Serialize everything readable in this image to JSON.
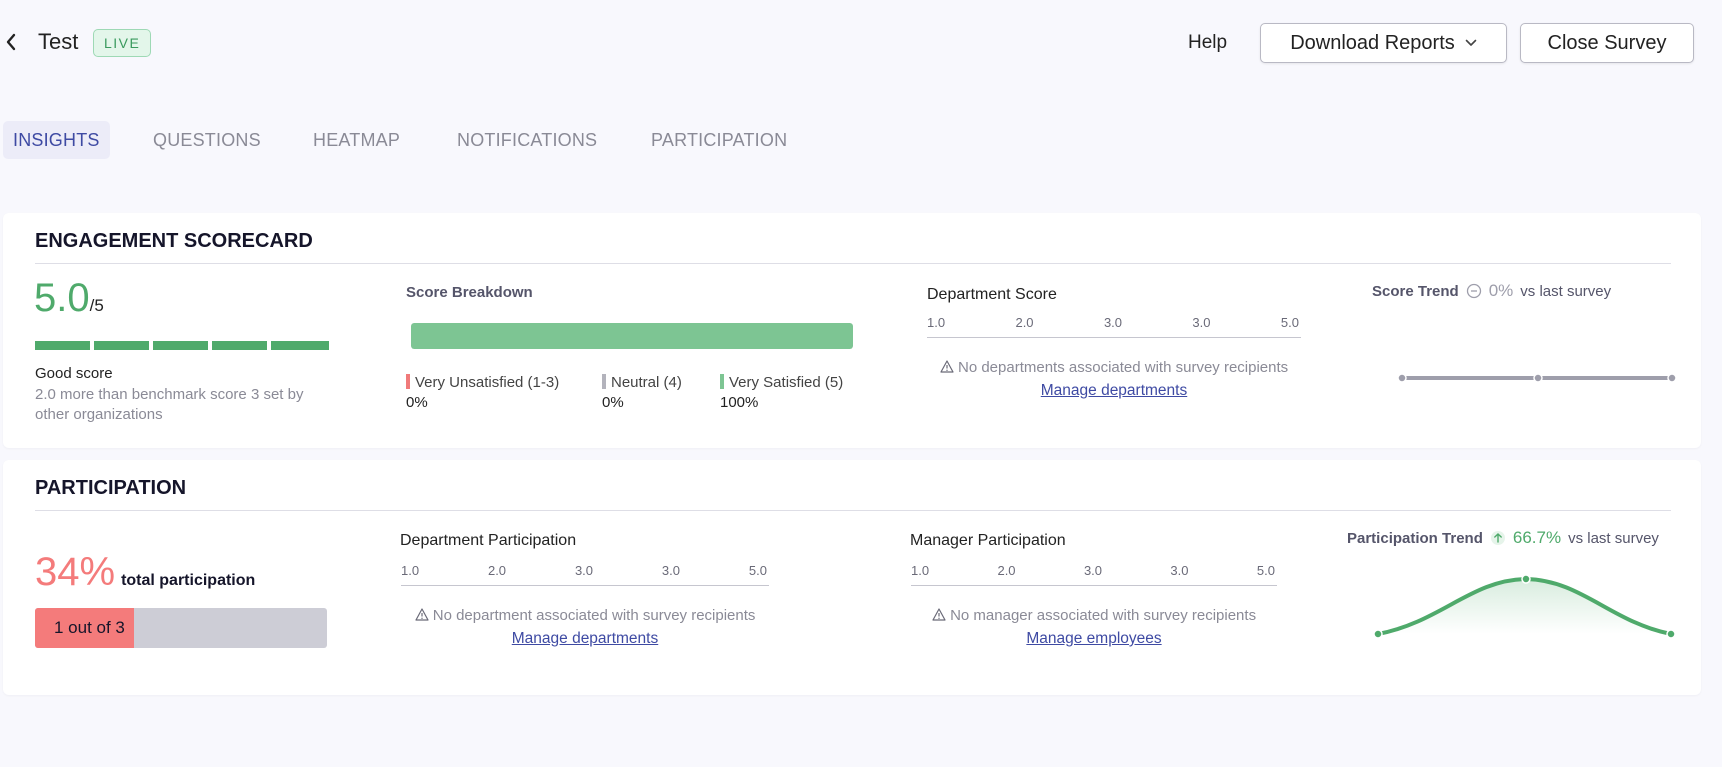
{
  "header": {
    "title": "Test",
    "status_badge": "LIVE",
    "help_label": "Help",
    "download_label": "Download Reports",
    "close_label": "Close Survey"
  },
  "tabs": [
    {
      "label": "INSIGHTS",
      "active": true
    },
    {
      "label": "QUESTIONS"
    },
    {
      "label": "HEATMAP"
    },
    {
      "label": "NOTIFICATIONS"
    },
    {
      "label": "PARTICIPATION"
    }
  ],
  "engagement": {
    "title": "ENGAGEMENT SCORECARD",
    "score": "5.0",
    "score_max": "/5",
    "score_label": "Good score",
    "score_description": "2.0 more than benchmark score 3 set by other organizations",
    "breakdown_title": "Score Breakdown",
    "breakdown": [
      {
        "label": "Very Unsatisfied (1-3)",
        "value": "0%",
        "color": "#f07a7a"
      },
      {
        "label": "Neutral (4)",
        "value": "0%",
        "color": "#b3b3bc"
      },
      {
        "label": "Very Satisfied (5)",
        "value": "100%",
        "color": "#7dc593"
      }
    ],
    "satisfied_fraction": 1.0,
    "department_title": "Department Score",
    "department_axis": [
      "1.0",
      "2.0",
      "3.0",
      "3.0",
      "5.0"
    ],
    "department_empty": "No departments associated with survey recipients",
    "manage_departments": "Manage departments",
    "trend_title": "Score Trend",
    "trend_value": "0%",
    "trend_suffix": "vs last survey",
    "trend_color": "#9e9eab"
  },
  "participation": {
    "title": "PARTICIPATION",
    "percent": "34%",
    "percent_label": "total participation",
    "bar_label": "1 out of 3",
    "fraction": 0.34,
    "bar_color": "#f47b7b",
    "dept_title": "Department Participation",
    "dept_axis": [
      "1.0",
      "2.0",
      "3.0",
      "3.0",
      "5.0"
    ],
    "dept_empty": "No department associated with survey recipients",
    "dept_manage": "Manage departments",
    "manager_title": "Manager Participation",
    "manager_axis": [
      "1.0",
      "2.0",
      "3.0",
      "3.0",
      "5.0"
    ],
    "manager_empty": "No manager associated with survey recipients",
    "manager_manage": "Manage employees",
    "trend_title": "Participation Trend",
    "trend_value": "66.7%",
    "trend_suffix": "vs last survey",
    "trend_color": "#4faa6b"
  },
  "icons": {
    "back": "chevron-left-icon",
    "dropdown": "chevron-down-icon",
    "warning": "warning-triangle-icon",
    "trend_neutral": "minus-circle-icon",
    "trend_up": "arrow-up-icon"
  },
  "colors": {
    "accent": "#3e4aa3",
    "good": "#4faa6b",
    "bad": "#f47b7b",
    "live_badge": "#3a9a5e"
  }
}
